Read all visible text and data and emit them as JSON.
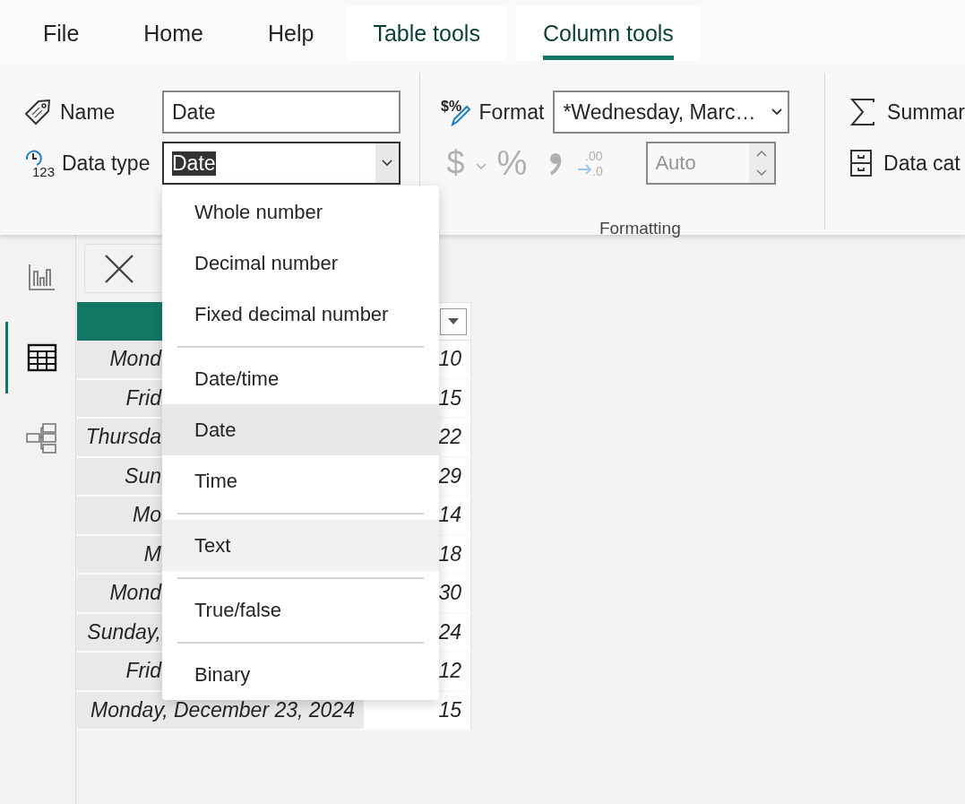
{
  "tabs": [
    {
      "label": "File",
      "contextual": false,
      "selected": false
    },
    {
      "label": "Home",
      "contextual": false,
      "selected": false
    },
    {
      "label": "Help",
      "contextual": false,
      "selected": false
    },
    {
      "label": "Table tools",
      "contextual": true,
      "selected": false
    },
    {
      "label": "Column tools",
      "contextual": true,
      "selected": true
    }
  ],
  "properties": {
    "name_label": "Name",
    "name_value": "Date",
    "type_label": "Data type",
    "type_icon_digits": "123",
    "type_value": "Date"
  },
  "formatting": {
    "icon_text": "$%",
    "format_label": "Format",
    "format_value": "*Wednesday, Marc…",
    "currency": "$",
    "percent": "%",
    "decimal_top": ".00",
    "decimal_bottom": ".0",
    "decimal_places_placeholder": "Auto",
    "disabled": true,
    "group_label": "Formatting"
  },
  "summary": {
    "summarization_label": "Summar",
    "category_label": "Data cat"
  },
  "rail": [
    {
      "kind": "report",
      "selected": false
    },
    {
      "kind": "table",
      "selected": true
    },
    {
      "kind": "model",
      "selected": false
    }
  ],
  "data_type_menu": [
    {
      "kind": "item",
      "label": "Whole number",
      "selected": false,
      "hovered": false
    },
    {
      "kind": "item",
      "label": "Decimal number",
      "selected": false,
      "hovered": false
    },
    {
      "kind": "item",
      "label": "Fixed decimal number",
      "selected": false,
      "hovered": false
    },
    {
      "kind": "separator"
    },
    {
      "kind": "item",
      "label": "Date/time",
      "selected": false,
      "hovered": false
    },
    {
      "kind": "item",
      "label": "Date",
      "selected": true,
      "hovered": false
    },
    {
      "kind": "item",
      "label": "Time",
      "selected": false,
      "hovered": false
    },
    {
      "kind": "separator"
    },
    {
      "kind": "item",
      "label": "Text",
      "selected": false,
      "hovered": true
    },
    {
      "kind": "separator"
    },
    {
      "kind": "item",
      "label": "True/false",
      "selected": false,
      "hovered": false
    },
    {
      "kind": "separator"
    },
    {
      "kind": "item",
      "label": "Binary",
      "selected": false,
      "hovered": false
    }
  ],
  "table": {
    "rows": [
      {
        "date": "Mond",
        "value": "10",
        "partly_hidden": true
      },
      {
        "date": "Frid",
        "value": "15",
        "partly_hidden": true
      },
      {
        "date": "Thursda",
        "value": "22",
        "partly_hidden": true
      },
      {
        "date": "Sun",
        "value": "29",
        "partly_hidden": true
      },
      {
        "date": "Mo",
        "value": "14",
        "partly_hidden": true
      },
      {
        "date": "M",
        "value": "18",
        "partly_hidden": true
      },
      {
        "date": "Mond",
        "value": "30",
        "partly_hidden": true
      },
      {
        "date": "Sunday,",
        "value": "24",
        "partly_hidden": true
      },
      {
        "date": "Frid",
        "value": "12",
        "partly_hidden": true
      },
      {
        "date": "Monday, December 23, 2024",
        "value": "15",
        "partly_hidden": false
      }
    ]
  }
}
